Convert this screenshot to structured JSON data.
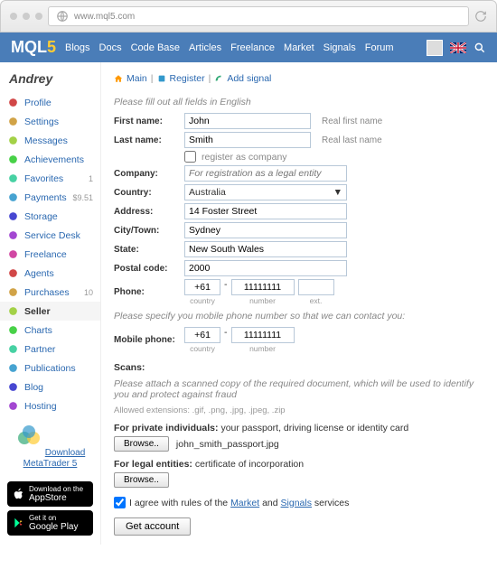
{
  "browser": {
    "url": "www.mql5.com"
  },
  "logo": {
    "text": "MQL",
    "suffix": "5"
  },
  "nav": [
    "Blogs",
    "Docs",
    "Code Base",
    "Articles",
    "Freelance",
    "Market",
    "Signals",
    "Forum"
  ],
  "user": {
    "name": "Andrey"
  },
  "sidebar": [
    {
      "label": "Profile",
      "badge": ""
    },
    {
      "label": "Settings",
      "badge": ""
    },
    {
      "label": "Messages",
      "badge": ""
    },
    {
      "label": "Achievements",
      "badge": ""
    },
    {
      "label": "Favorites",
      "badge": "1"
    },
    {
      "label": "Payments",
      "badge": "$9.51"
    },
    {
      "label": "Storage",
      "badge": ""
    },
    {
      "label": "Service Desk",
      "badge": ""
    },
    {
      "label": "Freelance",
      "badge": ""
    },
    {
      "label": "Agents",
      "badge": ""
    },
    {
      "label": "Purchases",
      "badge": "10"
    },
    {
      "label": "Seller",
      "badge": "",
      "active": true
    },
    {
      "label": "Charts",
      "badge": ""
    },
    {
      "label": "Partner",
      "badge": ""
    },
    {
      "label": "Publications",
      "badge": ""
    },
    {
      "label": "Blog",
      "badge": ""
    },
    {
      "label": "Hosting",
      "badge": ""
    }
  ],
  "promo": {
    "link": "Download MetaTrader 5"
  },
  "stores": {
    "apple": {
      "small": "Download on the",
      "big": "AppStore"
    },
    "google": {
      "small": "Get it on",
      "big": "Google Play"
    }
  },
  "crumbs": {
    "main": "Main",
    "register": "Register",
    "add": "Add signal"
  },
  "form": {
    "hint": "Please fill out all fields in English",
    "first_name_lbl": "First name:",
    "first_name": "John",
    "first_note": "Real first name",
    "last_name_lbl": "Last name:",
    "last_name": "Smith",
    "last_note": "Real last name",
    "reg_company": "register as company",
    "company_lbl": "Company:",
    "company_ph": "For registration as a legal entity",
    "country_lbl": "Country:",
    "country": "Australia",
    "address_lbl": "Address:",
    "address": "14 Foster Street",
    "city_lbl": "City/Town:",
    "city": "Sydney",
    "state_lbl": "State:",
    "state": "New South Wales",
    "postal_lbl": "Postal code:",
    "postal": "2000",
    "phone_lbl": "Phone:",
    "phone_cc": "+61",
    "phone_num": "11111111",
    "phone_ext": "",
    "sub_country": "country",
    "sub_number": "number",
    "sub_ext": "ext.",
    "mobile_hint": "Please specify you mobile phone number so that we can contact you:",
    "mobile_lbl": "Mobile phone:",
    "mobile_cc": "+61",
    "mobile_num": "11111111",
    "scans_head": "Scans:",
    "scans_hint": "Please attach a scanned copy of the required document, which will be used to identify you and protect against fraud",
    "allowed": "Allowed extensions: .gif, .png, .jpg, .jpeg, .zip",
    "private_lbl": "For private individuals:",
    "private_txt": "your passport, driving license or identity card",
    "browse": "Browse..",
    "uploaded": "john_smith_passport.jpg",
    "legal_lbl": "For legal entities:",
    "legal_txt": "certificate of incorporation",
    "agree_pre": "I agree with rules of the ",
    "agree_market": "Market",
    "agree_and": " and ",
    "agree_signals": "Signals",
    "agree_post": " services",
    "submit": "Get account"
  }
}
